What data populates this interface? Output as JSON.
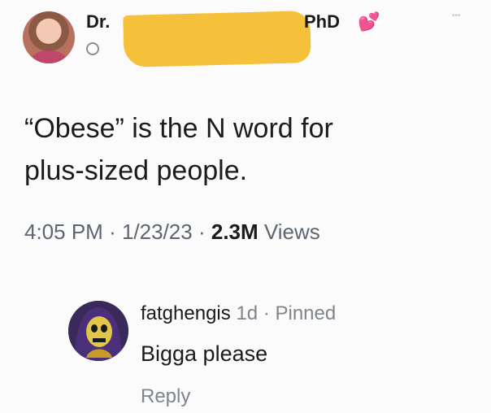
{
  "author": {
    "name_prefix": "Dr.",
    "name_suffix": "PhD",
    "badge_icon": "hearts-emoji-icon",
    "redaction_color": "#f6c13a"
  },
  "tweet": {
    "text": "“Obese” is the N word for\nplus-sized people.",
    "time": "4:05 PM",
    "date": "1/23/23",
    "views_count": "2.3M",
    "views_label": "Views",
    "separator": "·"
  },
  "comment": {
    "username": "fatghengis",
    "age": "1d",
    "pinned_label": "Pinned",
    "separator": "·",
    "text": "Bigga please",
    "reply_label": "Reply"
  }
}
